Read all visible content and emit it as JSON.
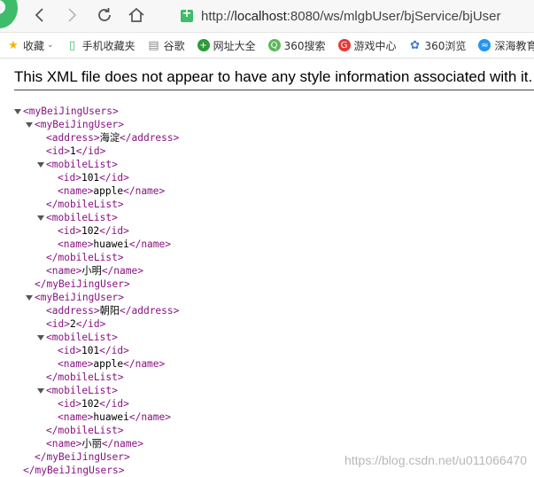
{
  "browser": {
    "url": {
      "prefix": "http://",
      "host": "localhost",
      "rest": ":8080/ws/mlgbUser/bjService/bjUser"
    }
  },
  "bookmarks": [
    {
      "label": "收藏",
      "icon": "star-icon",
      "color": "#f4b400",
      "has_caret": true
    },
    {
      "label": "手机收藏夹",
      "icon": "phone-icon",
      "color": "#3dbd6a",
      "has_caret": false
    },
    {
      "label": "谷歌",
      "icon": "page-icon",
      "color": "#888888",
      "has_caret": false
    },
    {
      "label": "网址大全",
      "icon": "plus-globe-icon",
      "color": "#2e9a3c",
      "has_caret": false
    },
    {
      "label": "360搜索",
      "icon": "search-q-icon",
      "color": "#5cb85c",
      "has_caret": false
    },
    {
      "label": "游戏中心",
      "icon": "game-icon",
      "color": "#e53935",
      "has_caret": false
    },
    {
      "label": "360浏览",
      "icon": "paw-icon",
      "color": "#3d7bd8",
      "has_caret": false
    },
    {
      "label": "深海教育",
      "icon": "wave-icon",
      "color": "#2196f3",
      "has_caret": false
    }
  ],
  "notice": "This XML file does not appear to have any style information associated with it.",
  "xml_lines": [
    {
      "depth": 0,
      "toggle": true,
      "kind": "open",
      "tag": "myBeiJingUsers"
    },
    {
      "depth": 1,
      "toggle": true,
      "kind": "open",
      "tag": "myBeiJingUser"
    },
    {
      "depth": 2,
      "toggle": false,
      "kind": "leaf",
      "tag": "address",
      "text": "海淀"
    },
    {
      "depth": 2,
      "toggle": false,
      "kind": "leaf",
      "tag": "id",
      "text": "1"
    },
    {
      "depth": 2,
      "toggle": true,
      "kind": "open",
      "tag": "mobileList"
    },
    {
      "depth": 3,
      "toggle": false,
      "kind": "leaf",
      "tag": "id",
      "text": "101"
    },
    {
      "depth": 3,
      "toggle": false,
      "kind": "leaf",
      "tag": "name",
      "text": "apple"
    },
    {
      "depth": 2,
      "toggle": false,
      "kind": "close",
      "tag": "mobileList"
    },
    {
      "depth": 2,
      "toggle": true,
      "kind": "open",
      "tag": "mobileList"
    },
    {
      "depth": 3,
      "toggle": false,
      "kind": "leaf",
      "tag": "id",
      "text": "102"
    },
    {
      "depth": 3,
      "toggle": false,
      "kind": "leaf",
      "tag": "name",
      "text": "huawei"
    },
    {
      "depth": 2,
      "toggle": false,
      "kind": "close",
      "tag": "mobileList"
    },
    {
      "depth": 2,
      "toggle": false,
      "kind": "leaf",
      "tag": "name",
      "text": "小明"
    },
    {
      "depth": 1,
      "toggle": false,
      "kind": "close",
      "tag": "myBeiJingUser"
    },
    {
      "depth": 1,
      "toggle": true,
      "kind": "open",
      "tag": "myBeiJingUser"
    },
    {
      "depth": 2,
      "toggle": false,
      "kind": "leaf",
      "tag": "address",
      "text": "朝阳"
    },
    {
      "depth": 2,
      "toggle": false,
      "kind": "leaf",
      "tag": "id",
      "text": "2"
    },
    {
      "depth": 2,
      "toggle": true,
      "kind": "open",
      "tag": "mobileList"
    },
    {
      "depth": 3,
      "toggle": false,
      "kind": "leaf",
      "tag": "id",
      "text": "101"
    },
    {
      "depth": 3,
      "toggle": false,
      "kind": "leaf",
      "tag": "name",
      "text": "apple"
    },
    {
      "depth": 2,
      "toggle": false,
      "kind": "close",
      "tag": "mobileList"
    },
    {
      "depth": 2,
      "toggle": true,
      "kind": "open",
      "tag": "mobileList"
    },
    {
      "depth": 3,
      "toggle": false,
      "kind": "leaf",
      "tag": "id",
      "text": "102"
    },
    {
      "depth": 3,
      "toggle": false,
      "kind": "leaf",
      "tag": "name",
      "text": "huawei"
    },
    {
      "depth": 2,
      "toggle": false,
      "kind": "close",
      "tag": "mobileList"
    },
    {
      "depth": 2,
      "toggle": false,
      "kind": "leaf",
      "tag": "name",
      "text": "小丽"
    },
    {
      "depth": 1,
      "toggle": false,
      "kind": "close",
      "tag": "myBeiJingUser"
    },
    {
      "depth": 0,
      "toggle": false,
      "kind": "close",
      "tag": "myBeiJingUsers"
    }
  ],
  "watermark": "https://blog.csdn.net/u011066470"
}
